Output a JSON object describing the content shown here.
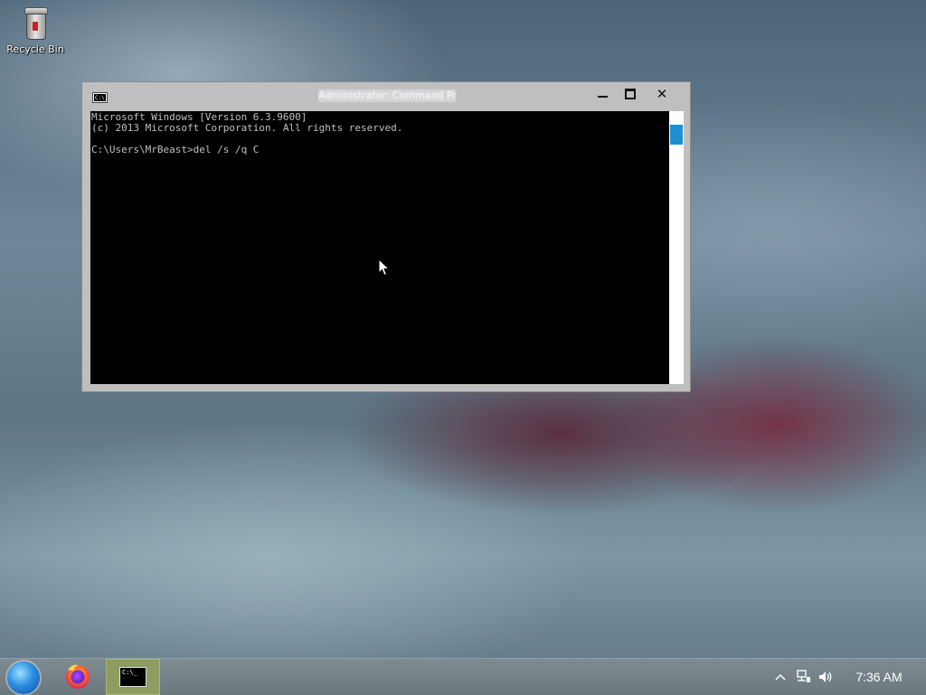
{
  "desktop": {
    "icons": [
      {
        "label": "Recycle Bin",
        "icon": "recycle-bin-icon"
      }
    ]
  },
  "window": {
    "title": "Administrator: Command Prompt",
    "icon": "cmd-icon",
    "controls": {
      "minimize": "minimize-icon",
      "maximize": "maximize-icon",
      "close": "✕"
    }
  },
  "console": {
    "lines": [
      "Microsoft Windows [Version 6.3.9600]",
      "(c) 2013 Microsoft Corporation. All rights reserved.",
      "",
      "C:\\Users\\MrBeast>del /s /q C"
    ]
  },
  "taskbar": {
    "start_icon": "start-orb-icon",
    "pinned": [
      "firefox-icon",
      "cmd-icon"
    ],
    "active_app": "Command Prompt",
    "tray_icons": [
      "chevron-up-icon",
      "network-icon",
      "volume-icon"
    ],
    "clock": "7:36 AM"
  },
  "colors": {
    "console_bg": "#000000",
    "console_fg": "#c0c0c0",
    "window_frame": "#bfbfbf",
    "scroll_thumb": "#1e90d0",
    "active_task": "#8d9d60"
  }
}
